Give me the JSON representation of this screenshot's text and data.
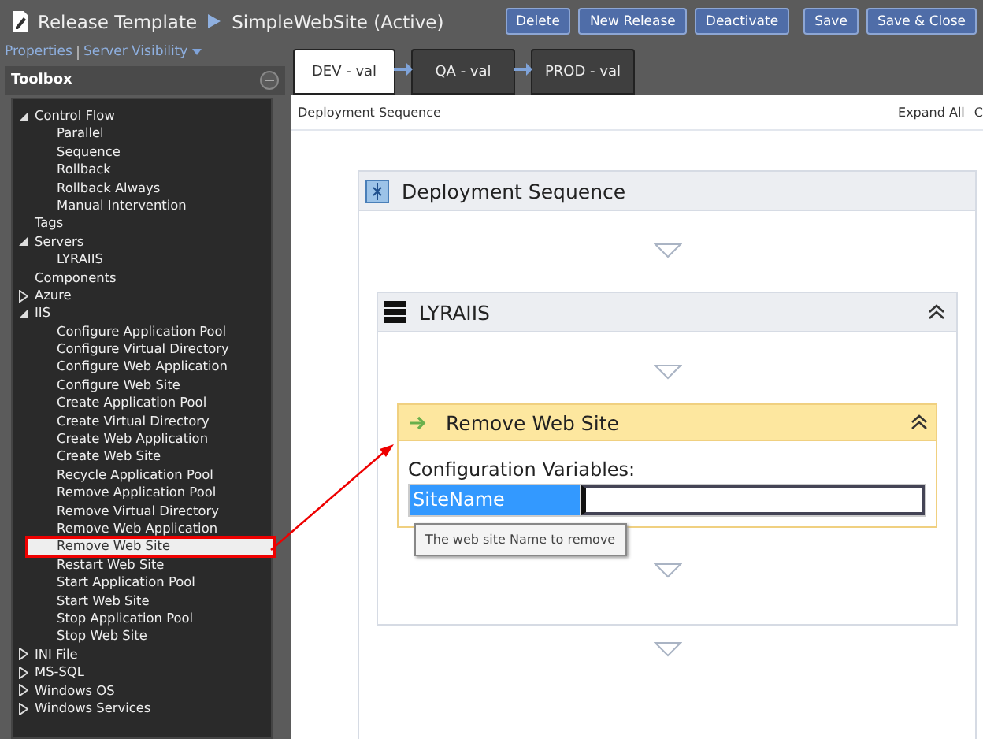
{
  "header": {
    "title": "Release Template",
    "subtitle": "SimpleWebSite (Active)",
    "buttons": [
      "Delete",
      "New Release",
      "Deactivate",
      "Save",
      "Save & Close"
    ]
  },
  "links": [
    "Properties",
    "Server Visibility"
  ],
  "toolbox": {
    "title": "Toolbox",
    "items": [
      {
        "label": "Control Flow",
        "expanded": true,
        "selected": false,
        "children": [
          {
            "label": "Parallel",
            "selected": false
          },
          {
            "label": "Sequence",
            "selected": false
          },
          {
            "label": "Rollback",
            "selected": false
          },
          {
            "label": "Rollback Always",
            "selected": false
          },
          {
            "label": "Manual Intervention",
            "selected": false
          }
        ]
      },
      {
        "label": "Tags",
        "selected": false
      },
      {
        "label": "Servers",
        "expanded": true,
        "selected": false,
        "children": [
          {
            "label": "LYRAIIS",
            "selected": false
          }
        ]
      },
      {
        "label": "Components",
        "selected": false
      },
      {
        "label": "Azure",
        "expanded": false,
        "selected": false
      },
      {
        "label": "IIS",
        "expanded": true,
        "selected": false,
        "children": [
          {
            "label": "Configure Application Pool",
            "selected": false
          },
          {
            "label": "Configure Virtual Directory",
            "selected": false
          },
          {
            "label": "Configure Web Application",
            "selected": false
          },
          {
            "label": "Configure Web Site",
            "selected": false
          },
          {
            "label": "Create Application Pool",
            "selected": false
          },
          {
            "label": "Create Virtual Directory",
            "selected": false
          },
          {
            "label": "Create Web Application",
            "selected": false
          },
          {
            "label": "Create Web Site",
            "selected": false
          },
          {
            "label": "Recycle Application Pool",
            "selected": false
          },
          {
            "label": "Remove Application Pool",
            "selected": false
          },
          {
            "label": "Remove Virtual Directory",
            "selected": false
          },
          {
            "label": "Remove Web Application",
            "selected": false
          },
          {
            "label": "Remove Web Site",
            "selected": true
          },
          {
            "label": "Restart Web Site",
            "selected": false
          },
          {
            "label": "Start Application Pool",
            "selected": false
          },
          {
            "label": "Start Web Site",
            "selected": false
          },
          {
            "label": "Stop Application Pool",
            "selected": false
          },
          {
            "label": "Stop Web Site",
            "selected": false
          }
        ]
      },
      {
        "label": "INI File",
        "expanded": false,
        "selected": false
      },
      {
        "label": "MS-SQL",
        "expanded": false,
        "selected": false
      },
      {
        "label": "Windows OS",
        "expanded": false,
        "selected": false
      },
      {
        "label": "Windows Services",
        "expanded": false,
        "selected": false
      }
    ]
  },
  "stages": [
    {
      "label": "DEV - val",
      "selected": true
    },
    {
      "label": "QA - val",
      "selected": false
    },
    {
      "label": "PROD - val",
      "selected": false
    }
  ],
  "canvas": {
    "breadcrumb": "Deployment Sequence",
    "expand_all": "Expand All",
    "collapse_cut": "C",
    "sequence": {
      "title": "Deployment Sequence",
      "server": {
        "title": "LYRAIIS",
        "action": {
          "title": "Remove Web Site",
          "section": "Configuration Variables:",
          "variable": "SiteName",
          "tooltip": "The web site Name to remove"
        }
      }
    }
  }
}
